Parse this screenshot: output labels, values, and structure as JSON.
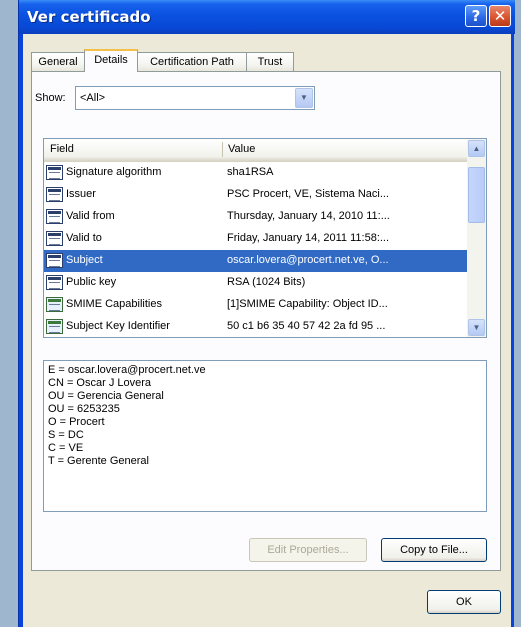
{
  "window": {
    "title": "Ver certificado"
  },
  "tabs": [
    {
      "label": "General"
    },
    {
      "label": "Details"
    },
    {
      "label": "Certification Path"
    },
    {
      "label": "Trust"
    }
  ],
  "show": {
    "label": "Show:",
    "selected": "<All>"
  },
  "list": {
    "columns": [
      "Field",
      "Value"
    ],
    "rows": [
      {
        "field": "Signature algorithm",
        "value": "sha1RSA",
        "icon": "document-icon"
      },
      {
        "field": "Issuer",
        "value": "PSC Procert, VE, Sistema Naci...",
        "icon": "document-icon"
      },
      {
        "field": "Valid from",
        "value": "Thursday, January 14, 2010 11:...",
        "icon": "document-icon"
      },
      {
        "field": "Valid to",
        "value": "Friday, January 14, 2011 11:58:...",
        "icon": "document-icon"
      },
      {
        "field": "Subject",
        "value": "oscar.lovera@procert.net.ve, O...",
        "icon": "document-icon",
        "selected": true
      },
      {
        "field": "Public key",
        "value": "RSA (1024 Bits)",
        "icon": "document-icon"
      },
      {
        "field": "SMIME Capabilities",
        "value": "[1]SMIME Capability: Object ID...",
        "icon": "certificate-extension-icon"
      },
      {
        "field": "Subject Key Identifier",
        "value": "50 c1 b6 35 40 57 42 2a fd 95 ...",
        "icon": "certificate-extension-icon"
      }
    ]
  },
  "details": {
    "lines": [
      "E = oscar.lovera@procert.net.ve",
      "CN = Oscar J Lovera",
      "OU = Gerencia General",
      "OU = 6253235",
      "O = Procert",
      "S = DC",
      "C = VE",
      "T = Gerente General"
    ]
  },
  "buttons": {
    "edit_properties": "Edit Properties...",
    "copy_to_file": "Copy to File...",
    "ok": "OK"
  },
  "colors": {
    "titlebar": "#0a51e0",
    "selection": "#316ac5",
    "dialog_bg": "#ece9d8"
  }
}
